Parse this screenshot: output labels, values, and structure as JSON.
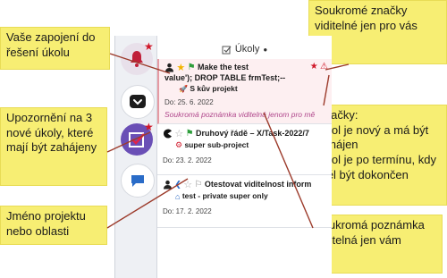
{
  "callouts": {
    "zapojeni": "Vaše zapojení do řešení úkolu",
    "upozorneni": "Upozornění na 3 nové úkoly, které mají být zahájeny",
    "projekt": "Jméno projektu nebo oblasti",
    "soukrome": "Soukromé značky viditelné jen pro vás",
    "znacky_title": "Značky:",
    "znacky_line1": "Úkol je nový a má být zahájen",
    "znacky_line2": "Úkol je po termínu, kdy měl být dokončen",
    "poznamka": "Soukromá poznámka viditelná jen vám"
  },
  "header": {
    "title": "Úkoly"
  },
  "tasks": [
    {
      "title": "Make the test",
      "subtitle": "value'); DROP TABLE frmTest;--",
      "project": "S kův projekt",
      "date": "Do: 25. 6. 2022",
      "note": "Soukromá poznámka viditelná jenom pro mě"
    },
    {
      "title": "Druhový řádě – X/Task-2022/7",
      "project": "super sub-project",
      "date": "Do: 23. 2. 2022"
    },
    {
      "title": "Otestovat viditelnost inform",
      "project": "test - private super only",
      "date": "Do: 17. 2. 2022"
    }
  ],
  "colors": {
    "callout_bg": "#f7ee73",
    "leader_line": "#9c3a2a",
    "accent_purple": "#6a4fb6",
    "badge_red": "#d0182a",
    "note_pink": "#b0478c"
  },
  "icons": {
    "sidebar": [
      "bell-icon",
      "pocket-icon",
      "tasks-checkbox-icon",
      "chat-icon"
    ],
    "task": [
      "person-icon",
      "star-icon",
      "flag-icon",
      "private-star-icon",
      "warning-icon"
    ]
  }
}
